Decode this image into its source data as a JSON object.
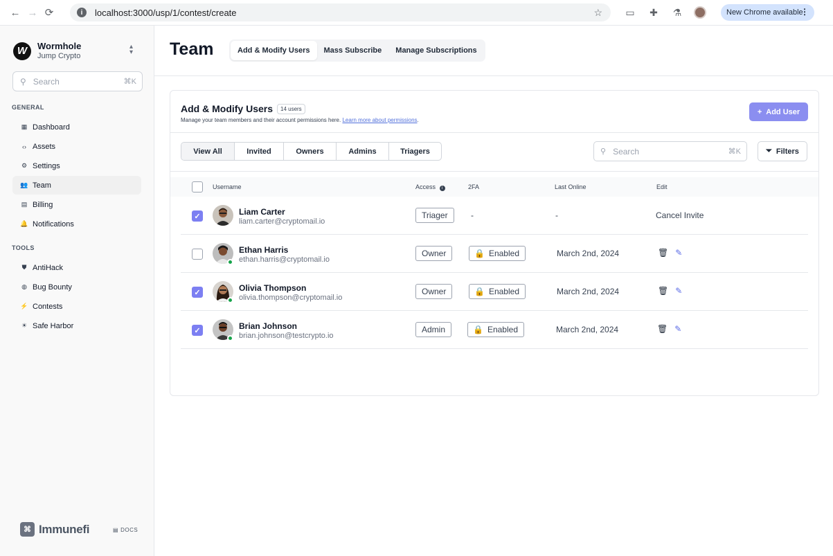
{
  "browser": {
    "url": "localhost:3000/usp/1/contest/create",
    "update_label": "New Chrome available"
  },
  "sidebar": {
    "org_name": "Wormhole",
    "org_sub": "Jump Crypto",
    "org_logo_letter": "W",
    "search_placeholder": "Search",
    "search_shortcut": "⌘K",
    "general_label": "GENERAL",
    "tools_label": "TOOLS",
    "general_items": [
      {
        "label": "Dashboard",
        "icon": "grid-icon"
      },
      {
        "label": "Assets",
        "icon": "code-icon"
      },
      {
        "label": "Settings",
        "icon": "gear-icon"
      },
      {
        "label": "Team",
        "icon": "users-icon",
        "active": true
      },
      {
        "label": "Billing",
        "icon": "billing-icon"
      },
      {
        "label": "Notifications",
        "icon": "bell-icon"
      }
    ],
    "tool_items": [
      {
        "label": "AntiHack",
        "icon": "shield-icon"
      },
      {
        "label": "Bug Bounty",
        "icon": "globe-icon"
      },
      {
        "label": "Contests",
        "icon": "bolt-icon"
      },
      {
        "label": "Safe Harbor",
        "icon": "sun-icon"
      }
    ],
    "brand_name": "Immunefi",
    "docs_label": "DOCS"
  },
  "header": {
    "title": "Team",
    "tabs": [
      "Add & Modify Users",
      "Mass Subscribe",
      "Manage Subscriptions"
    ],
    "active_tab": 0
  },
  "card": {
    "title": "Add & Modify Users",
    "count_badge": "14 users",
    "description": "Manage your team members and their account permissions here.",
    "learn_more": "Learn more about permissions",
    "description_end": ".",
    "add_user_label": "Add User",
    "filter_tabs": [
      "View All",
      "Invited",
      "Owners",
      "Admins",
      "Triagers"
    ],
    "active_filter": 0,
    "search_placeholder": "Search",
    "search_shortcut": "⌘K",
    "filters_label": "Filters"
  },
  "table": {
    "columns": {
      "username": "Username",
      "access": "Access",
      "twofa": "2FA",
      "last_online": "Last Online",
      "edit": "Edit"
    },
    "rows": [
      {
        "name": "Liam Carter",
        "email": "liam.carter@cryptomail.io",
        "access": "Triager",
        "twofa": "-",
        "last_online": "-",
        "edit": "Cancel Invite",
        "checked": true,
        "online": false
      },
      {
        "name": "Ethan Harris",
        "email": "ethan.harris@cryptomail.io",
        "access": "Owner",
        "twofa": "Enabled",
        "last_online": "March 2nd, 2024",
        "edit": "",
        "checked": false,
        "online": true
      },
      {
        "name": "Olivia Thompson",
        "email": "olivia.thompson@cryptomail.io",
        "access": "Owner",
        "twofa": "Enabled",
        "last_online": "March 2nd, 2024",
        "edit": "",
        "checked": true,
        "online": true
      },
      {
        "name": "Brian Johnson",
        "email": "brian.johnson@testcrypto.io",
        "access": "Admin",
        "twofa": "Enabled",
        "last_online": "March 2nd, 2024",
        "edit": "",
        "checked": true,
        "online": true
      }
    ]
  },
  "colors": {
    "accent": "#8b8ef0",
    "checkbox": "#7c7ff2",
    "online": "#16a34a",
    "link": "#4f6edb"
  }
}
